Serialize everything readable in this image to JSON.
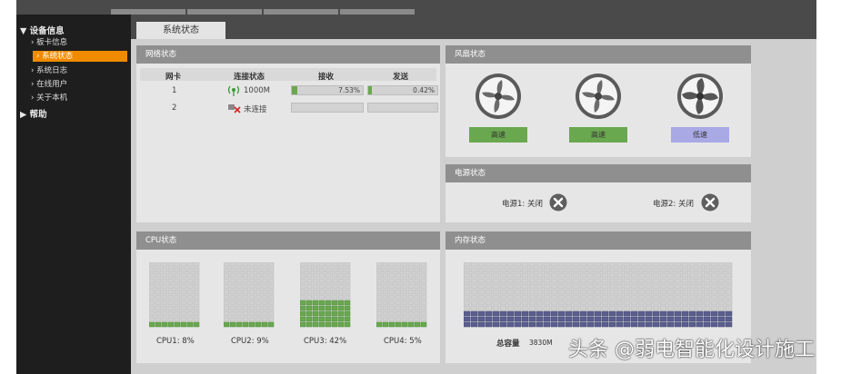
{
  "sidebar": {
    "device_info_label": "▼ 设备信息",
    "items": [
      {
        "label": "› 板卡信息"
      },
      {
        "label": "› 系统状态"
      },
      {
        "label": "› 系统日志"
      },
      {
        "label": "› 在线用户"
      },
      {
        "label": "› 关于本机"
      }
    ],
    "help_label": "▶ 帮助"
  },
  "tabs": {
    "active_label": "系统状态"
  },
  "network_panel": {
    "title": "网络状态",
    "headers": [
      "网卡",
      "连接状态",
      "接收",
      "发送"
    ],
    "rows": [
      {
        "nic": "1",
        "status": "1000M",
        "recv": "7.53%",
        "recv_frac": 0.0753,
        "send": "0.42%",
        "send_frac": 0.0042
      },
      {
        "nic": "2",
        "status": "未连接",
        "recv": "",
        "recv_frac": 0,
        "send": "",
        "send_frac": 0
      }
    ]
  },
  "fan_panel": {
    "title": "风扇状态",
    "fans": [
      {
        "label": "高速",
        "color": "#6aa84f"
      },
      {
        "label": "高速",
        "color": "#6aa84f"
      },
      {
        "label": "低速",
        "color": "#a9a9e6"
      }
    ]
  },
  "power_panel": {
    "title": "电源状态",
    "items": [
      {
        "label": "电源1: 关闭"
      },
      {
        "label": "电源2: 关闭"
      }
    ]
  },
  "cpu_panel": {
    "title": "CPU状态",
    "cpus": [
      {
        "label": "CPU1: 8%",
        "load": 0.08
      },
      {
        "label": "CPU2: 9%",
        "load": 0.09
      },
      {
        "label": "CPU3: 42%",
        "load": 0.42
      },
      {
        "label": "CPU4: 5%",
        "load": 0.05
      }
    ]
  },
  "memory_panel": {
    "title": "内存状态",
    "total_label": "总容量",
    "total_value": "3830M",
    "used_fraction": 0.22
  },
  "colors": {
    "accent": "#f08b00",
    "ok_green": "#6aa84f",
    "memory_blue": "#5b5f8f"
  },
  "watermark": "头条 @弱电智能化设计施工"
}
